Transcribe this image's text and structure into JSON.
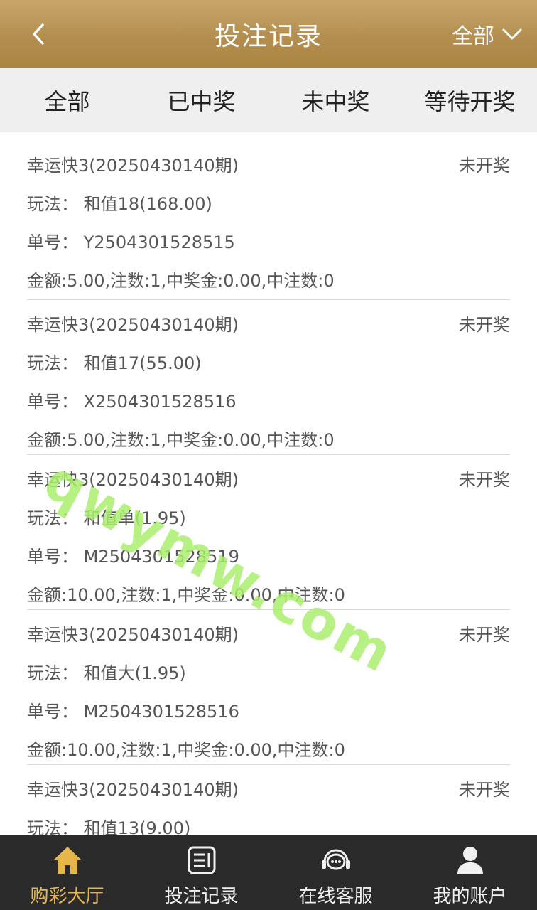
{
  "header": {
    "title": "投注记录",
    "filter_label": "全部",
    "colors": {
      "bar": "#b38e50",
      "title": "#ffffff"
    }
  },
  "tabs": [
    {
      "label": "全部"
    },
    {
      "label": "已中奖"
    },
    {
      "label": "未中奖"
    },
    {
      "label": "等待开奖"
    }
  ],
  "records": [
    {
      "game": "幸运快3(20250430140期)",
      "status": "未开奖",
      "play": "玩法：  和值18(168.00)",
      "order": "单号：  Y2504301528515",
      "summary": "金额:5.00,注数:1,中奖金:0.00,中注数:0"
    },
    {
      "game": "幸运快3(20250430140期)",
      "status": "未开奖",
      "play": "玩法：  和值17(55.00)",
      "order": "单号：  X2504301528516",
      "summary": "金额:5.00,注数:1,中奖金:0.00,中注数:0"
    },
    {
      "game": "幸运快3(20250430140期)",
      "status": "未开奖",
      "play": "玩法：  和值单(1.95)",
      "order": "单号：  M2504301528519",
      "summary": "金额:10.00,注数:1,中奖金:0.00,中注数:0"
    },
    {
      "game": "幸运快3(20250430140期)",
      "status": "未开奖",
      "play": "玩法：  和值大(1.95)",
      "order": "单号：  M2504301528516",
      "summary": "金额:10.00,注数:1,中奖金:0.00,中注数:0"
    },
    {
      "game": "幸运快3(20250430140期)",
      "status": "未开奖",
      "play": "玩法：  和值13(9.00)",
      "order": "",
      "summary": ""
    }
  ],
  "watermark": "qwymw.com",
  "bottom_nav": [
    {
      "label": "购彩大厅",
      "icon": "home-icon",
      "active": true
    },
    {
      "label": "投注记录",
      "icon": "bet-record-icon",
      "active": false
    },
    {
      "label": "在线客服",
      "icon": "customer-service-icon",
      "active": false
    },
    {
      "label": "我的账户",
      "icon": "user-icon",
      "active": false
    }
  ],
  "colors": {
    "active_nav": "#e6b64b",
    "nav_bg": "#2a2a2a",
    "tab_bg": "#efefef"
  }
}
